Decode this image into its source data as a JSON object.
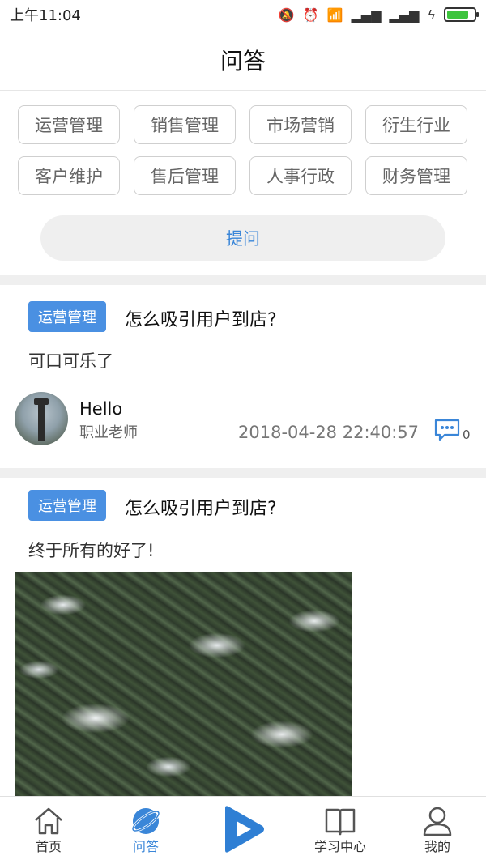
{
  "status": {
    "time": "上午11:04",
    "battery_level": 0.8
  },
  "header": {
    "title": "问答"
  },
  "categories": [
    "运营管理",
    "销售管理",
    "市场营销",
    "衍生行业",
    "客户维护",
    "售后管理",
    "人事行政",
    "财务管理"
  ],
  "ask_button": "提问",
  "posts": [
    {
      "tag": "运营管理",
      "question": "怎么吸引用户到店?",
      "answer": "可口可乐了",
      "user": {
        "name": "Hello",
        "role": "职业老师"
      },
      "timestamp": "2018-04-28 22:40:57",
      "comment_count": "0"
    },
    {
      "tag": "运营管理",
      "question": "怎么吸引用户到店?",
      "answer": "终于所有的好了!"
    }
  ],
  "tabs": [
    {
      "label": "首页",
      "icon": "home-icon"
    },
    {
      "label": "问答",
      "icon": "planet-icon"
    },
    {
      "label": "",
      "icon": "play-icon"
    },
    {
      "label": "学习中心",
      "icon": "book-icon"
    },
    {
      "label": "我的",
      "icon": "user-icon"
    }
  ],
  "colors": {
    "accent": "#3a86d8",
    "tag_bg": "#4a90e2",
    "divider": "#efefef"
  }
}
